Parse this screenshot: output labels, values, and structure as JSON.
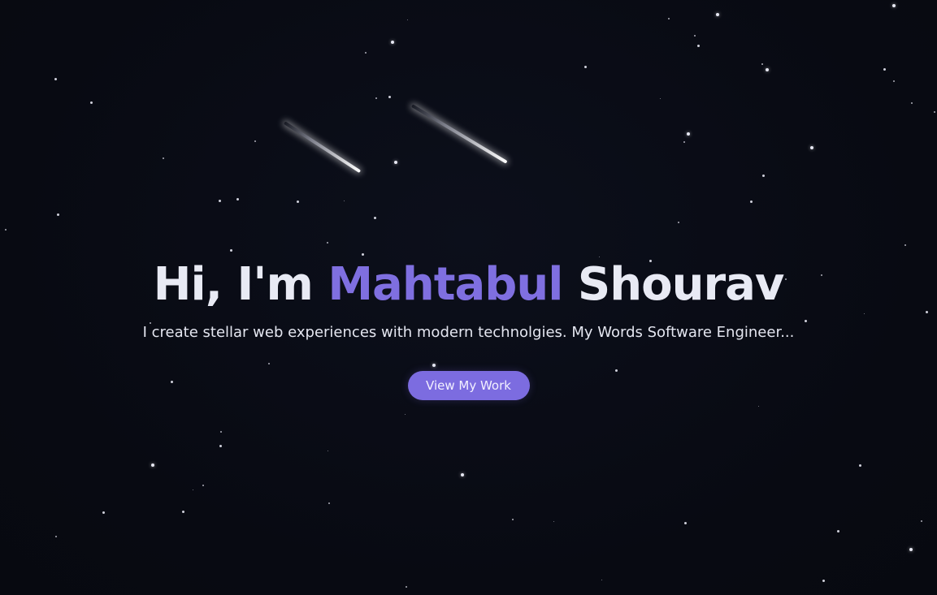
{
  "hero": {
    "greeting": "Hi, I'm",
    "first_name": "Mahtabul",
    "last_name": "Shourav",
    "tagline": "I create stellar web experiences with modern technolgies. My Words Software Engineer...",
    "cta_label": "View My Work"
  },
  "theme": {
    "background": "#090b14",
    "accent": "#7f6fe0",
    "button": "#7c6ce0",
    "text": "#e8eaf4"
  }
}
